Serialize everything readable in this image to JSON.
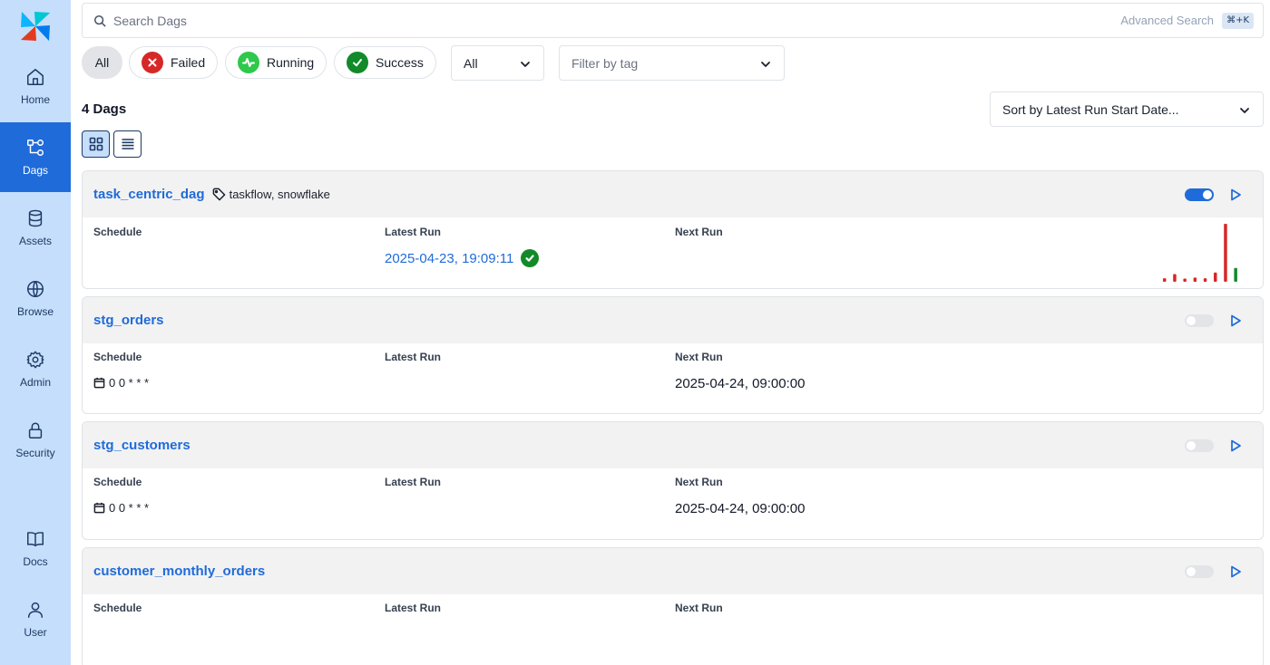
{
  "sidebar": {
    "items": [
      {
        "label": "Home",
        "icon": "home-icon"
      },
      {
        "label": "Dags",
        "icon": "dags-icon",
        "active": true
      },
      {
        "label": "Assets",
        "icon": "database-icon"
      },
      {
        "label": "Browse",
        "icon": "globe-icon"
      },
      {
        "label": "Admin",
        "icon": "gear-icon"
      },
      {
        "label": "Security",
        "icon": "lock-icon"
      },
      {
        "label": "Docs",
        "icon": "book-icon"
      },
      {
        "label": "User",
        "icon": "user-icon"
      }
    ]
  },
  "search": {
    "placeholder": "Search Dags",
    "advanced_label": "Advanced Search",
    "shortcut": "⌘+K"
  },
  "filters": {
    "all_label": "All",
    "failed_label": "Failed",
    "running_label": "Running",
    "success_label": "Success",
    "paused_select_value": "All",
    "tag_placeholder": "Filter by tag"
  },
  "colors": {
    "accent": "#1f6bd9",
    "sidebar_bg": "#c5defb",
    "failed": "#d62828",
    "running": "#2ec84a",
    "success": "#128a2a"
  },
  "summary": {
    "count_label": "4 Dags",
    "sort_label": "Sort by Latest Run Start Date..."
  },
  "columns": {
    "schedule": "Schedule",
    "latest_run": "Latest Run",
    "next_run": "Next Run"
  },
  "dags": [
    {
      "name": "task_centric_dag",
      "tags": "taskflow, snowflake",
      "enabled": true,
      "schedule": "",
      "latest_run": "2025-04-23, 19:09:11",
      "latest_state": "success",
      "next_run": "",
      "recent_runs": [
        {
          "state": "failed",
          "duration": 1.1
        },
        {
          "state": "failed",
          "duration": 2.4
        },
        {
          "state": "failed",
          "duration": 1.0
        },
        {
          "state": "failed",
          "duration": 1.3
        },
        {
          "state": "failed",
          "duration": 1.1
        },
        {
          "state": "failed",
          "duration": 2.9
        },
        {
          "state": "failed",
          "duration": 18.0
        },
        {
          "state": "success",
          "duration": 4.3
        }
      ]
    },
    {
      "name": "stg_orders",
      "tags": "",
      "enabled": false,
      "schedule": "0 0 * * *",
      "latest_run": "",
      "next_run": "2025-04-24, 09:00:00"
    },
    {
      "name": "stg_customers",
      "tags": "",
      "enabled": false,
      "schedule": "0 0 * * *",
      "latest_run": "",
      "next_run": "2025-04-24, 09:00:00"
    },
    {
      "name": "customer_monthly_orders",
      "tags": "",
      "enabled": false,
      "schedule": "",
      "latest_run": "",
      "next_run": ""
    }
  ]
}
